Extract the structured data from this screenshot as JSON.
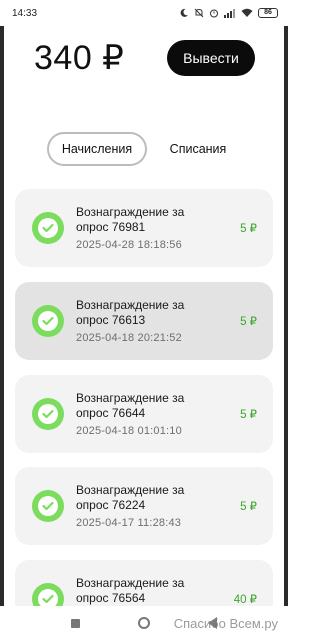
{
  "status_bar": {
    "time": "14:33",
    "battery": "86",
    "icons": [
      "moon-icon",
      "mute-icon",
      "alarm-icon",
      "signal-icon",
      "wifi-icon",
      "battery-icon"
    ]
  },
  "header": {
    "balance": "340 ₽",
    "withdraw_label": "Вывести"
  },
  "tabs": {
    "accruals": "Начисления",
    "writeoffs": "Списания",
    "active": "accruals"
  },
  "transactions": [
    {
      "title": "Вознаграждение за опрос 76981",
      "date": "2025-04-28 18:18:56",
      "amount": "5 ₽",
      "highlighted": false
    },
    {
      "title": "Вознаграждение за опрос 76613",
      "date": "2025-04-18 20:21:52",
      "amount": "5 ₽",
      "highlighted": true
    },
    {
      "title": "Вознаграждение за опрос 76644",
      "date": "2025-04-18 01:01:10",
      "amount": "5 ₽",
      "highlighted": false
    },
    {
      "title": "Вознаграждение за опрос 76224",
      "date": "2025-04-17 11:28:43",
      "amount": "5 ₽",
      "highlighted": false
    },
    {
      "title": "Вознаграждение за опрос 76564",
      "date": "",
      "amount": "40 ₽",
      "highlighted": false
    }
  ],
  "colors": {
    "accent_green": "#7cdc5e",
    "amount_green": "#3aa62a",
    "button_dark": "#0b0b0b"
  },
  "watermark": "Спасибо Всем.ру"
}
